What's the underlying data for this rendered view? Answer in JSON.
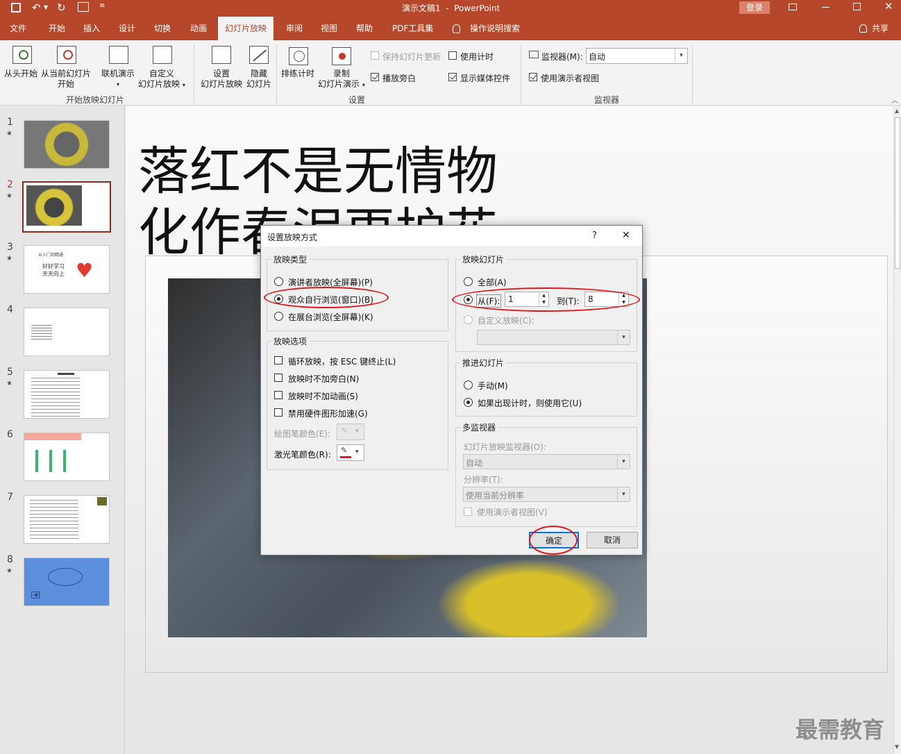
{
  "titlebar": {
    "title": "演示文稿1  -  PowerPoint",
    "login": "登录"
  },
  "tabs": [
    "文件",
    "开始",
    "插入",
    "设计",
    "切换",
    "动画",
    "幻灯片放映",
    "审阅",
    "视图",
    "帮助",
    "PDF工具集",
    "操作说明搜索"
  ],
  "active_tab": "幻灯片放映",
  "share": "共享",
  "ribbon": {
    "from_start": "从头开始",
    "from_current_1": "从当前幻灯片",
    "from_current_2": "开始",
    "online": "联机演示",
    "custom_1": "自定义",
    "custom_2": "幻灯片放映",
    "group_start": "开始放映幻灯片",
    "setup_1": "设置",
    "setup_2": "幻灯片放映",
    "hide_1": "隐藏",
    "hide_2": "幻灯片",
    "rehearse": "排练计时",
    "record_1": "录制",
    "record_2": "幻灯片演示",
    "keep_updated": "保持幻灯片更新",
    "use_timings": "使用计时",
    "play_narrations": "播放旁白",
    "show_media": "显示媒体控件",
    "group_setup": "设置",
    "monitor_label": "监视器(M):",
    "monitor_value": "自动",
    "presenter_view": "使用演示者视图",
    "group_monitor": "监视器"
  },
  "thumbnails": [
    {
      "num": "1",
      "star": "★"
    },
    {
      "num": "2",
      "star": "★"
    },
    {
      "num": "3",
      "star": "★",
      "line1": "从入门到精通",
      "line2": "好好学习",
      "line3": "天天向上"
    },
    {
      "num": "4",
      "star": ""
    },
    {
      "num": "5",
      "star": "★"
    },
    {
      "num": "6",
      "star": ""
    },
    {
      "num": "7",
      "star": ""
    },
    {
      "num": "8",
      "star": "★"
    }
  ],
  "slide": {
    "title_line1": "落红不是无情物",
    "title_line2": "化作春泥更护花"
  },
  "dialog": {
    "title": "设置放映方式",
    "help": "?",
    "close": "✕",
    "show_type": "放映类型",
    "presenter_full": "演讲者放映(全屏幕)(P)",
    "individual_window": "观众自行浏览(窗口)(B)",
    "kiosk_full": "在展台浏览(全屏幕)(K)",
    "show_options": "放映选项",
    "loop": "循环放映，按 ESC 键终止(L)",
    "no_narration": "放映时不加旁白(N)",
    "no_animation": "放映时不加动画(S)",
    "disable_hw": "禁用硬件图形加速(G)",
    "pen_color": "绘图笔颜色(E):",
    "laser_color": "激光笔颜色(R):",
    "show_slides": "放映幻灯片",
    "all": "全部(A)",
    "from": "从(F):",
    "from_value": "1",
    "to": "到(T):",
    "to_value": "8",
    "custom_show": "自定义放映(C):",
    "advance": "推进幻灯片",
    "manual": "手动(M)",
    "use_timings": "如果出现计时，则使用它(U)",
    "multi_monitor": "多监视器",
    "slideshow_monitor": "幻灯片放映监视器(O):",
    "slideshow_monitor_value": "自动",
    "resolution": "分辨率(T):",
    "resolution_value": "使用当前分辨率",
    "use_presenter": "使用演示者视图(V)",
    "ok": "确定",
    "cancel": "取消",
    "laser_color_hex": "#e81123"
  },
  "watermark": "最需教育",
  "colors": {
    "accent": "#b7472a",
    "highlight": "#e0161b"
  }
}
